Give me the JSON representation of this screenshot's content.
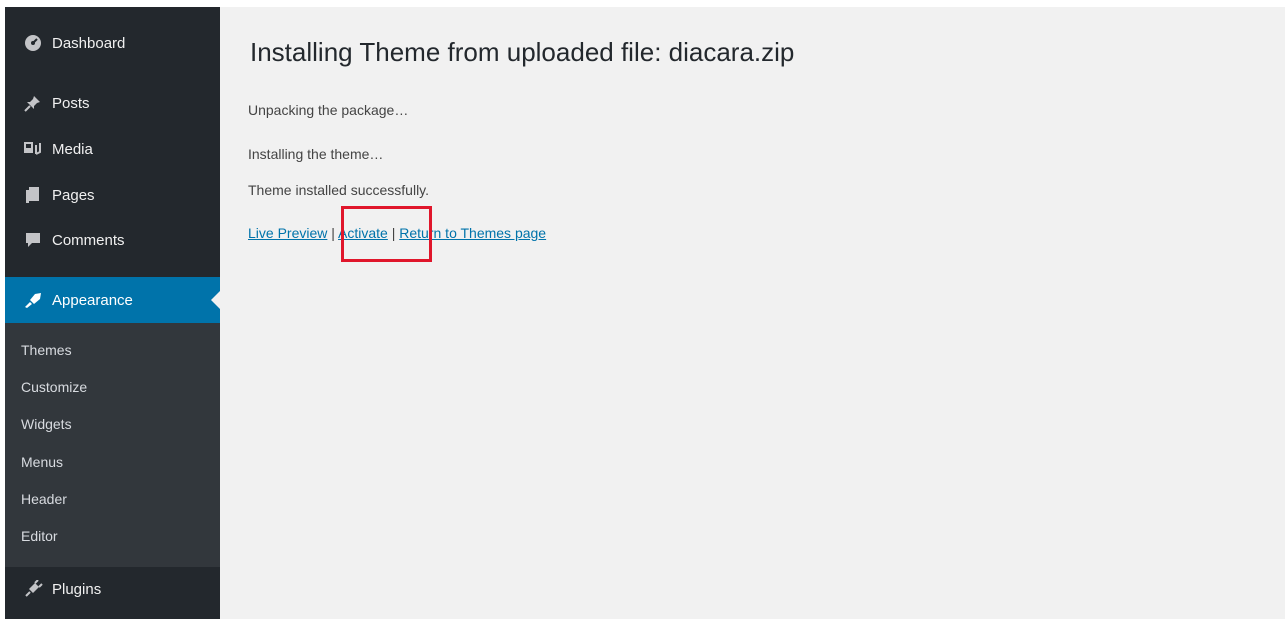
{
  "sidebar": {
    "items": [
      {
        "label": "Dashboard",
        "icon": "dashboard-icon"
      },
      {
        "label": "Posts",
        "icon": "pin-icon"
      },
      {
        "label": "Media",
        "icon": "media-icon"
      },
      {
        "label": "Pages",
        "icon": "pages-icon"
      },
      {
        "label": "Comments",
        "icon": "comment-icon"
      },
      {
        "label": "Appearance",
        "icon": "paintbrush-icon",
        "active": true
      },
      {
        "label": "Plugins",
        "icon": "plugin-icon"
      }
    ],
    "submenu": [
      "Themes",
      "Customize",
      "Widgets",
      "Menus",
      "Header",
      "Editor"
    ]
  },
  "main": {
    "title": "Installing Theme from uploaded file: diacara.zip",
    "messages": [
      "Unpacking the package…",
      "Installing the theme…",
      "Theme installed successfully."
    ],
    "links": {
      "live_preview": "Live Preview",
      "activate": "Activate",
      "return": "Return to Themes page",
      "separator": "|"
    }
  },
  "colors": {
    "sidebar_bg": "#23282d",
    "submenu_bg": "#32373c",
    "active_bg": "#0073aa",
    "link": "#0073aa",
    "highlight": "#e0162b",
    "content_bg": "#f1f1f1"
  }
}
